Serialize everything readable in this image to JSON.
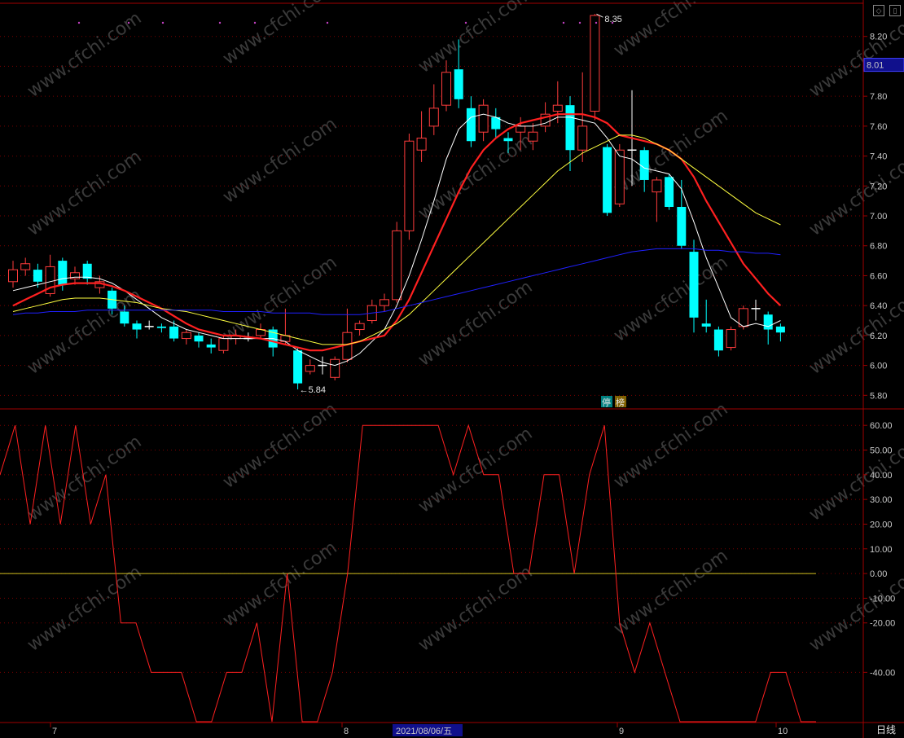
{
  "chart_data": {
    "type": "candlestick",
    "price_axis": {
      "ticks": [
        8.2,
        8.0,
        7.8,
        7.6,
        7.4,
        7.2,
        7.0,
        6.8,
        6.6,
        6.4,
        6.2,
        6.0,
        5.8
      ],
      "ylim": [
        5.72,
        8.4
      ]
    },
    "current_price": {
      "label": "8.01",
      "value": 8.01
    },
    "high_annotation": {
      "label": "8.35",
      "value": 8.35
    },
    "low_annotation": {
      "label": "←5.84",
      "value": 5.84
    },
    "candles": [
      {
        "o": 6.56,
        "c": 6.64,
        "h": 6.7,
        "l": 6.52
      },
      {
        "o": 6.64,
        "c": 6.68,
        "h": 6.72,
        "l": 6.6
      },
      {
        "o": 6.64,
        "c": 6.56,
        "h": 6.68,
        "l": 6.52
      },
      {
        "o": 6.48,
        "c": 6.66,
        "h": 6.74,
        "l": 6.46
      },
      {
        "o": 6.7,
        "c": 6.54,
        "h": 6.72,
        "l": 6.5
      },
      {
        "o": 6.58,
        "c": 6.62,
        "h": 6.66,
        "l": 6.54
      },
      {
        "o": 6.68,
        "c": 6.58,
        "h": 6.7,
        "l": 6.54
      },
      {
        "o": 6.52,
        "c": 6.56,
        "h": 6.6,
        "l": 6.48
      },
      {
        "o": 6.5,
        "c": 6.38,
        "h": 6.52,
        "l": 6.34
      },
      {
        "o": 6.36,
        "c": 6.28,
        "h": 6.4,
        "l": 6.26
      },
      {
        "o": 6.28,
        "c": 6.24,
        "h": 6.3,
        "l": 6.18
      },
      {
        "o": 6.26,
        "c": 6.26,
        "h": 6.3,
        "l": 6.24
      },
      {
        "o": 6.26,
        "c": 6.25,
        "h": 6.28,
        "l": 6.22
      },
      {
        "o": 6.26,
        "c": 6.18,
        "h": 6.3,
        "l": 6.16
      },
      {
        "o": 6.18,
        "c": 6.22,
        "h": 6.24,
        "l": 6.14
      },
      {
        "o": 6.2,
        "c": 6.16,
        "h": 6.22,
        "l": 6.12
      },
      {
        "o": 6.14,
        "c": 6.12,
        "h": 6.18,
        "l": 6.08
      },
      {
        "o": 6.1,
        "c": 6.18,
        "h": 6.2,
        "l": 6.08
      },
      {
        "o": 6.18,
        "c": 6.2,
        "h": 6.24,
        "l": 6.14
      },
      {
        "o": 6.18,
        "c": 6.18,
        "h": 6.22,
        "l": 6.16
      },
      {
        "o": 6.2,
        "c": 6.24,
        "h": 6.28,
        "l": 6.18
      },
      {
        "o": 6.24,
        "c": 6.12,
        "h": 6.26,
        "l": 6.06
      },
      {
        "o": 6.16,
        "c": 6.2,
        "h": 6.38,
        "l": 6.14
      },
      {
        "o": 6.1,
        "c": 5.88,
        "h": 6.12,
        "l": 5.84
      },
      {
        "o": 5.96,
        "c": 6.0,
        "h": 6.04,
        "l": 5.94
      },
      {
        "o": 6.0,
        "c": 6.0,
        "h": 6.06,
        "l": 5.94
      },
      {
        "o": 5.92,
        "c": 6.04,
        "h": 6.06,
        "l": 5.9
      },
      {
        "o": 6.04,
        "c": 6.22,
        "h": 6.38,
        "l": 6.02
      },
      {
        "o": 6.24,
        "c": 6.28,
        "h": 6.3,
        "l": 6.2
      },
      {
        "o": 6.3,
        "c": 6.4,
        "h": 6.44,
        "l": 6.28
      },
      {
        "o": 6.4,
        "c": 6.44,
        "h": 6.48,
        "l": 6.36
      },
      {
        "o": 6.44,
        "c": 6.9,
        "h": 6.96,
        "l": 6.42
      },
      {
        "o": 6.9,
        "c": 7.5,
        "h": 7.55,
        "l": 6.84
      },
      {
        "o": 7.44,
        "c": 7.52,
        "h": 7.7,
        "l": 7.36
      },
      {
        "o": 7.6,
        "c": 7.72,
        "h": 7.88,
        "l": 7.54
      },
      {
        "o": 7.74,
        "c": 7.96,
        "h": 8.04,
        "l": 7.7
      },
      {
        "o": 7.98,
        "c": 7.78,
        "h": 8.18,
        "l": 7.72
      },
      {
        "o": 7.72,
        "c": 7.5,
        "h": 7.8,
        "l": 7.46
      },
      {
        "o": 7.56,
        "c": 7.74,
        "h": 7.78,
        "l": 7.5
      },
      {
        "o": 7.66,
        "c": 7.58,
        "h": 7.72,
        "l": 7.52
      },
      {
        "o": 7.52,
        "c": 7.5,
        "h": 7.56,
        "l": 7.42
      },
      {
        "o": 7.56,
        "c": 7.6,
        "h": 7.66,
        "l": 7.44
      },
      {
        "o": 7.5,
        "c": 7.56,
        "h": 7.62,
        "l": 7.44
      },
      {
        "o": 7.6,
        "c": 7.68,
        "h": 7.76,
        "l": 7.56
      },
      {
        "o": 7.7,
        "c": 7.74,
        "h": 7.9,
        "l": 7.62
      },
      {
        "o": 7.74,
        "c": 7.44,
        "h": 7.8,
        "l": 7.3
      },
      {
        "o": 7.44,
        "c": 7.6,
        "h": 7.96,
        "l": 7.36
      },
      {
        "o": 7.7,
        "c": 8.34,
        "h": 8.35,
        "l": 7.64
      },
      {
        "o": 7.46,
        "c": 7.02,
        "h": 7.48,
        "l": 7.0
      },
      {
        "o": 7.08,
        "c": 7.44,
        "h": 7.48,
        "l": 7.06
      },
      {
        "o": 7.44,
        "c": 7.44,
        "h": 7.84,
        "l": 7.2
      },
      {
        "o": 7.44,
        "c": 7.24,
        "h": 7.46,
        "l": 7.16
      },
      {
        "o": 7.16,
        "c": 7.24,
        "h": 7.26,
        "l": 6.96
      },
      {
        "o": 7.26,
        "c": 7.06,
        "h": 7.28,
        "l": 7.04
      },
      {
        "o": 7.06,
        "c": 6.8,
        "h": 7.24,
        "l": 6.78
      },
      {
        "o": 6.76,
        "c": 6.32,
        "h": 6.84,
        "l": 6.22
      },
      {
        "o": 6.28,
        "c": 6.26,
        "h": 6.44,
        "l": 6.22
      },
      {
        "o": 6.24,
        "c": 6.1,
        "h": 6.26,
        "l": 6.06
      },
      {
        "o": 6.12,
        "c": 6.24,
        "h": 6.26,
        "l": 6.1
      },
      {
        "o": 6.26,
        "c": 6.38,
        "h": 6.4,
        "l": 6.24
      },
      {
        "o": 6.38,
        "c": 6.38,
        "h": 6.44,
        "l": 6.3
      },
      {
        "o": 6.34,
        "c": 6.24,
        "h": 6.36,
        "l": 6.14
      },
      {
        "o": 6.26,
        "c": 6.22,
        "h": 6.28,
        "l": 6.16
      }
    ],
    "ma_lines": [
      {
        "color": "#ffffff",
        "values": [
          6.5,
          6.52,
          6.54,
          6.56,
          6.58,
          6.59,
          6.59,
          6.58,
          6.55,
          6.5,
          6.44,
          6.38,
          6.32,
          6.28,
          6.24,
          6.22,
          6.2,
          6.18,
          6.18,
          6.18,
          6.18,
          6.18,
          6.16,
          6.1,
          6.06,
          6.02,
          6.0,
          6.03,
          6.08,
          6.16,
          6.24,
          6.4,
          6.6,
          6.84,
          7.1,
          7.38,
          7.58,
          7.66,
          7.68,
          7.66,
          7.62,
          7.6,
          7.6,
          7.62,
          7.66,
          7.66,
          7.64,
          7.62,
          7.52,
          7.4,
          7.38,
          7.32,
          7.3,
          7.28,
          7.18,
          6.96,
          6.72,
          6.52,
          6.32,
          6.26,
          6.28,
          6.26,
          6.3
        ]
      },
      {
        "color": "#ff2020",
        "values": [
          6.4,
          6.44,
          6.48,
          6.52,
          6.54,
          6.55,
          6.55,
          6.55,
          6.53,
          6.5,
          6.46,
          6.42,
          6.38,
          6.33,
          6.28,
          6.24,
          6.22,
          6.2,
          6.2,
          6.19,
          6.18,
          6.16,
          6.14,
          6.12,
          6.1,
          6.1,
          6.12,
          6.14,
          6.16,
          6.18,
          6.2,
          6.3,
          6.44,
          6.62,
          6.8,
          6.98,
          7.16,
          7.32,
          7.44,
          7.52,
          7.58,
          7.62,
          7.64,
          7.66,
          7.68,
          7.68,
          7.68,
          7.66,
          7.62,
          7.54,
          7.52,
          7.5,
          7.48,
          7.44,
          7.38,
          7.26,
          7.1,
          6.96,
          6.82,
          6.68,
          6.58,
          6.48,
          6.4
        ]
      },
      {
        "color": "#ffff40",
        "values": [
          6.36,
          6.38,
          6.4,
          6.42,
          6.44,
          6.45,
          6.45,
          6.45,
          6.44,
          6.43,
          6.42,
          6.4,
          6.38,
          6.37,
          6.36,
          6.34,
          6.32,
          6.3,
          6.28,
          6.26,
          6.24,
          6.22,
          6.2,
          6.18,
          6.16,
          6.14,
          6.14,
          6.14,
          6.16,
          6.2,
          6.24,
          6.28,
          6.34,
          6.42,
          6.5,
          6.58,
          6.66,
          6.74,
          6.82,
          6.9,
          6.98,
          7.06,
          7.14,
          7.22,
          7.3,
          7.36,
          7.42,
          7.46,
          7.5,
          7.54,
          7.54,
          7.52,
          7.48,
          7.44,
          7.38,
          7.32,
          7.26,
          7.2,
          7.14,
          7.08,
          7.02,
          6.98,
          6.94
        ]
      },
      {
        "color": "#2020ff",
        "values": [
          6.34,
          6.35,
          6.35,
          6.36,
          6.36,
          6.36,
          6.37,
          6.37,
          6.37,
          6.37,
          6.37,
          6.37,
          6.37,
          6.37,
          6.37,
          6.37,
          6.37,
          6.36,
          6.36,
          6.36,
          6.36,
          6.35,
          6.35,
          6.35,
          6.35,
          6.34,
          6.34,
          6.34,
          6.34,
          6.35,
          6.36,
          6.38,
          6.4,
          6.42,
          6.44,
          6.46,
          6.48,
          6.5,
          6.52,
          6.54,
          6.56,
          6.58,
          6.6,
          6.62,
          6.64,
          6.66,
          6.68,
          6.7,
          6.72,
          6.74,
          6.76,
          6.77,
          6.78,
          6.78,
          6.78,
          6.78,
          6.77,
          6.77,
          6.76,
          6.76,
          6.75,
          6.75,
          6.74
        ]
      }
    ],
    "badges": [
      "停",
      "榜"
    ],
    "osc_axis": {
      "ticks": [
        60.0,
        50.0,
        40.0,
        30.0,
        20.0,
        10.0,
        0.0,
        -10.0,
        -20.0,
        -40.0
      ],
      "ylim": [
        -60,
        66
      ]
    },
    "osc_values": [
      40,
      60,
      20,
      60,
      20,
      60,
      20,
      40,
      -20,
      -20,
      -40,
      -40,
      -40,
      -60,
      -60,
      -40,
      -40,
      -20,
      -60,
      0,
      -60,
      -60,
      -40,
      0,
      60,
      60,
      60,
      60,
      60,
      60,
      40,
      60,
      40,
      40,
      0,
      0,
      40,
      40,
      0,
      40,
      60,
      -20,
      -40,
      -20,
      -40,
      -60,
      -60,
      -60,
      -60,
      -60,
      -60,
      -40,
      -40,
      -60,
      -60
    ],
    "osc_zero_line": 0,
    "x_labels": [
      "7",
      "8",
      "2021/08/06/五",
      "9",
      "10"
    ],
    "period": "日线",
    "watermark": "www.cfchi.com"
  }
}
